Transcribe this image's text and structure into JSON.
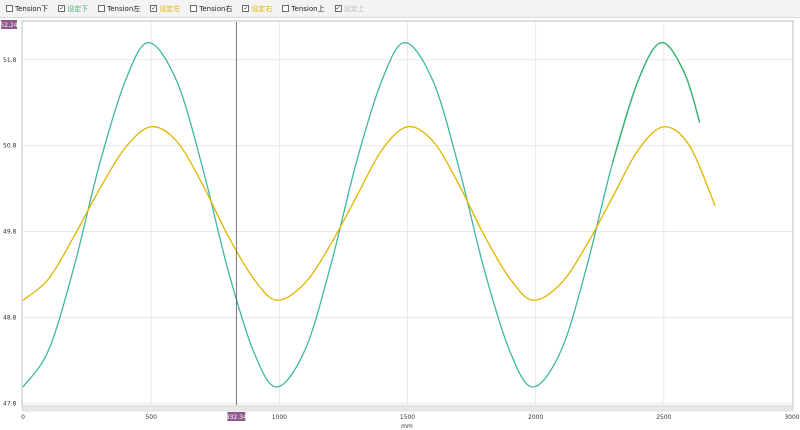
{
  "legend": [
    {
      "label": "Tension下",
      "checked": false,
      "color": "#222222"
    },
    {
      "label": "设定下",
      "checked": true,
      "color": "#3cb371"
    },
    {
      "label": "Tension左",
      "checked": false,
      "color": "#222222"
    },
    {
      "label": "设定左",
      "checked": true,
      "color": "#e0b400"
    },
    {
      "label": "Tension右",
      "checked": false,
      "color": "#222222"
    },
    {
      "label": "设定右",
      "checked": true,
      "color": "#e0b400"
    },
    {
      "label": "Tension上",
      "checked": false,
      "color": "#222222"
    },
    {
      "label": "设定上",
      "checked": true,
      "color": "#bbbbbb"
    }
  ],
  "cursor": {
    "x": 832.34,
    "y_value": 52.24,
    "x_label": "832.34",
    "y_label": "52.24"
  },
  "chart_data": {
    "type": "line",
    "xlabel": "mm",
    "ylabel": "",
    "xlim": [
      0,
      3000
    ],
    "ylim": [
      47.78,
      52.24
    ],
    "x_ticks": [
      0,
      500,
      1000,
      1500,
      2000,
      2500,
      3000
    ],
    "y_ticks": [
      47.8,
      48.8,
      49.8,
      50.8,
      51.8
    ],
    "grid": true,
    "series": [
      {
        "color": "#3cb8a0",
        "end_color": "#3cb371",
        "x": [
          0,
          100,
          200,
          300,
          400,
          490,
          600,
          700,
          800,
          900,
          990,
          1100,
          1200,
          1300,
          1400,
          1490,
          1600,
          1700,
          1800,
          1900,
          1990,
          2100,
          2200,
          2300,
          2400,
          2490,
          2580,
          2640
        ],
        "y": [
          47.99,
          48.42,
          49.4,
          50.6,
          51.56,
          52.0,
          51.55,
          50.55,
          49.35,
          48.4,
          47.99,
          48.42,
          49.4,
          50.6,
          51.56,
          52.0,
          51.55,
          50.55,
          49.35,
          48.4,
          47.99,
          48.42,
          49.4,
          50.6,
          51.56,
          52.0,
          51.65,
          51.07
        ]
      },
      {
        "color": "#e0b400",
        "x": [
          0,
          100,
          200,
          300,
          400,
          500,
          600,
          700,
          800,
          900,
          990,
          1100,
          1200,
          1300,
          1400,
          1500,
          1600,
          1700,
          1800,
          1900,
          1990,
          2100,
          2200,
          2300,
          2400,
          2500,
          2600,
          2700
        ],
        "y": [
          49.0,
          49.25,
          49.75,
          50.3,
          50.78,
          51.02,
          50.85,
          50.35,
          49.75,
          49.25,
          49.0,
          49.2,
          49.65,
          50.2,
          50.75,
          51.02,
          50.85,
          50.35,
          49.75,
          49.25,
          49.0,
          49.2,
          49.65,
          50.2,
          50.75,
          51.02,
          50.8,
          50.1
        ]
      }
    ]
  }
}
